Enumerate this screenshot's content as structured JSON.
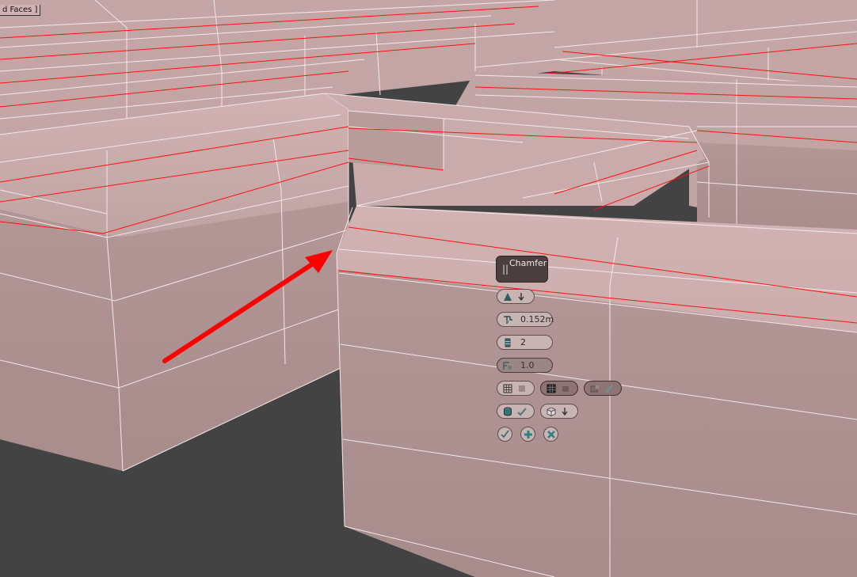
{
  "viewport": {
    "label": "d Faces ]",
    "colors": {
      "background": "#434343",
      "mesh_face": "#b69a9a",
      "edge": "#ffffff",
      "selected_edge": "#ff0000",
      "arrow": "#ff0000"
    }
  },
  "caddy": {
    "title": "Chamfer",
    "grip_icon": "grip-icon",
    "rows": [
      {
        "name": "chamfer-mode",
        "icons": [
          "chamfer-type-icon",
          "arrow-down-icon"
        ],
        "value": ""
      },
      {
        "name": "amount",
        "icons": [
          "amount-icon"
        ],
        "value": "0.152m"
      },
      {
        "name": "segments",
        "icons": [
          "segments-icon"
        ],
        "value": "2"
      },
      {
        "name": "tension",
        "icons": [
          "tension-icon"
        ],
        "value": "1.0"
      }
    ],
    "toggles": [
      {
        "name": "open-chamfer",
        "icons": [
          "grid-icon",
          "square-icon"
        ]
      },
      {
        "name": "quad-intersection",
        "icons": [
          "grid-icon",
          "folder-icon"
        ]
      },
      {
        "name": "smooth-chamfer",
        "icons": [
          "smooth-icon",
          "brush-icon"
        ]
      },
      {
        "name": "map-ids",
        "icons": [
          "cylinder-icon",
          "check-pen-icon"
        ]
      },
      {
        "name": "smooth-type",
        "icons": [
          "cube-icon",
          "arrow-down-icon"
        ]
      }
    ],
    "actions": [
      "ok-icon",
      "apply-continue-icon",
      "cancel-icon"
    ]
  }
}
